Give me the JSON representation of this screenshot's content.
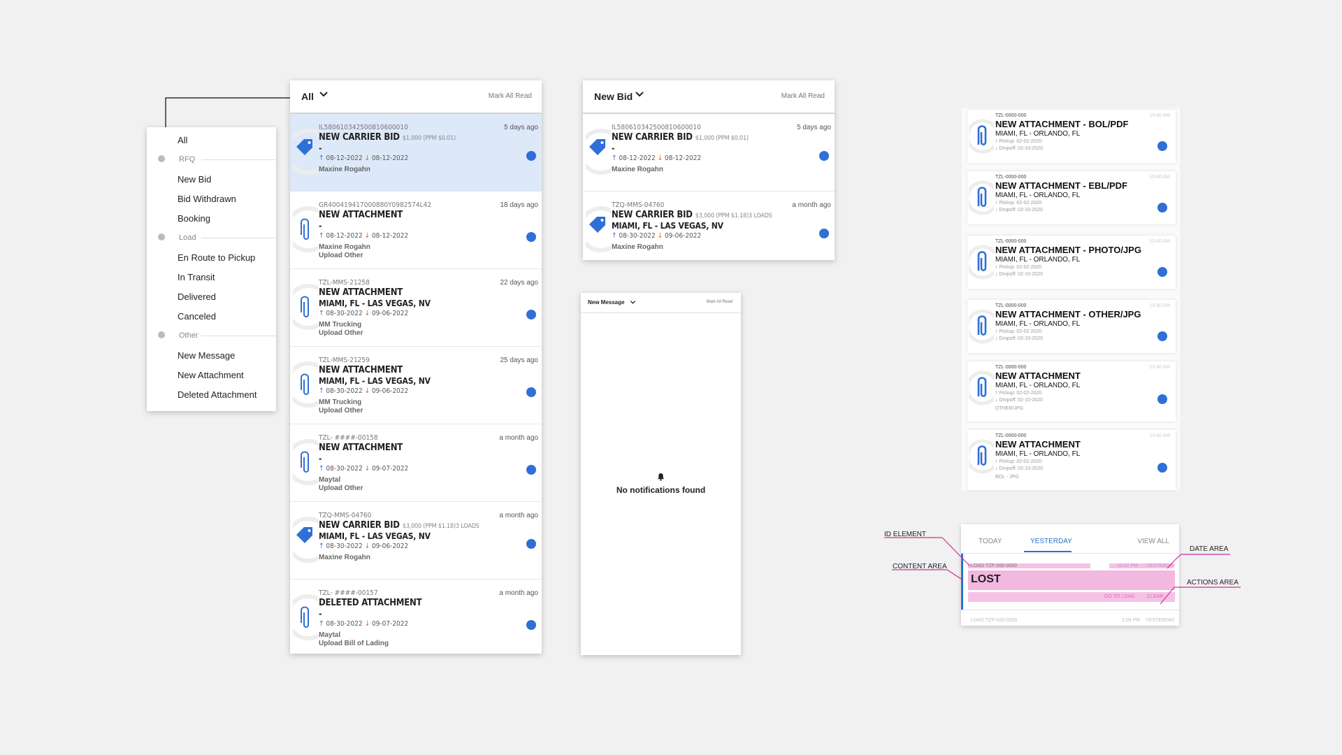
{
  "colors": {
    "accent": "#2f6fd6",
    "highlight_row": "#dde9f8",
    "pickup_arrow": "#2b72c9",
    "dropoff_arrow": "#e8671c",
    "annotation_magenta": "#d0309a",
    "annotation_fill": "#f5c2e6"
  },
  "filter_dropdown": {
    "items": [
      {
        "label": "All",
        "kind": "item"
      },
      {
        "label": "RFQ",
        "kind": "group",
        "icon": "tag-icon"
      },
      {
        "label": "New Bid",
        "kind": "item"
      },
      {
        "label": "Bid Withdrawn",
        "kind": "item"
      },
      {
        "label": "Booking",
        "kind": "item"
      },
      {
        "label": "Load",
        "kind": "group",
        "icon": "truck-icon"
      },
      {
        "label": "En Route to Pickup",
        "kind": "item"
      },
      {
        "label": "In Transit",
        "kind": "item"
      },
      {
        "label": "Delivered",
        "kind": "item"
      },
      {
        "label": "Canceled",
        "kind": "item"
      },
      {
        "label": "Other",
        "kind": "group",
        "icon": "chat-icon"
      },
      {
        "label": "New Message",
        "kind": "item"
      },
      {
        "label": "New Attachment",
        "kind": "item"
      },
      {
        "label": "Deleted Attachment",
        "kind": "item"
      }
    ]
  },
  "panel_all": {
    "filter_label": "All",
    "mark_all_read": "Mark All Read",
    "items": [
      {
        "icon": "tag-icon",
        "code": "IL580610342500810600010",
        "time": "5 days ago",
        "title": "NEW CARRIER BID",
        "extra": "$1,000 (PPM $0.01)",
        "route": "-",
        "pickup": "08-12-2022",
        "dropoff": "08-12-2022",
        "who": "Maxine Rogahn",
        "sub": "",
        "highlighted": true
      },
      {
        "icon": "paperclip-icon",
        "code": "GR400419417000880Y0982574L42",
        "time": "18 days ago",
        "title": "NEW ATTACHMENT",
        "extra": "",
        "route": "-",
        "pickup": "08-12-2022",
        "dropoff": "08-12-2022",
        "who": "Maxine Rogahn",
        "sub": "Upload Other",
        "highlighted": false
      },
      {
        "icon": "paperclip-icon",
        "code": "TZL-MMS-21258",
        "time": "22 days ago",
        "title": "NEW ATTACHMENT",
        "extra": "",
        "route": "MIAMI, FL - LAS VEGAS, NV",
        "pickup": "08-30-2022",
        "dropoff": "09-06-2022",
        "who": "MM Trucking",
        "sub": "Upload Other",
        "highlighted": false
      },
      {
        "icon": "paperclip-icon",
        "code": "TZL-MMS-21259",
        "time": "25 days ago",
        "title": "NEW ATTACHMENT",
        "extra": "",
        "route": "MIAMI, FL - LAS VEGAS, NV",
        "pickup": "08-30-2022",
        "dropoff": "09-06-2022",
        "who": "MM Trucking",
        "sub": "Upload Other",
        "highlighted": false
      },
      {
        "icon": "paperclip-icon",
        "code": "TZL- ####-00158",
        "time": "a month ago",
        "title": "NEW ATTACHMENT",
        "extra": "",
        "route": "-",
        "pickup": "08-30-2022",
        "dropoff": "09-07-2022",
        "who": "Maytal",
        "sub": "Upload Other",
        "highlighted": false
      },
      {
        "icon": "tag-icon",
        "code": "TZQ-MMS-04760",
        "time": "a month ago",
        "title": "NEW CARRIER BID",
        "extra": "$3,000 (PPM $1.18)3 LOADS",
        "route": "MIAMI, FL - LAS VEGAS, NV",
        "pickup": "08-30-2022",
        "dropoff": "09-06-2022",
        "who": "Maxine Rogahn",
        "sub": "",
        "highlighted": false
      },
      {
        "icon": "paperclip-icon",
        "code": "TZL- ####-00157",
        "time": "a month ago",
        "title": "DELETED ATTACHMENT",
        "extra": "",
        "route": "-",
        "pickup": "08-30-2022",
        "dropoff": "09-07-2022",
        "who": "Maytal",
        "sub": "Upload Bill of Lading",
        "highlighted": false
      }
    ]
  },
  "panel_newbid": {
    "filter_label": "New Bid",
    "mark_all_read": "Mark All Read",
    "items": [
      {
        "icon": "tag-icon",
        "code": "IL580610342500810600010",
        "time": "5 days ago",
        "title": "NEW CARRIER BID",
        "extra": "$1,000 (PPM $0.01)",
        "route": "-",
        "pickup": "08-12-2022",
        "dropoff": "08-12-2022",
        "who": "Maxine Rogahn",
        "sub": ""
      },
      {
        "icon": "tag-icon",
        "code": "TZQ-MMS-04760",
        "time": "a month ago",
        "title": "NEW CARRIER BID",
        "extra": "$3,000 (PPM $1.18)3 LOADS",
        "route": "MIAMI, FL - LAS VEGAS, NV",
        "pickup": "08-30-2022",
        "dropoff": "09-06-2022",
        "who": "Maxine Rogahn",
        "sub": ""
      }
    ]
  },
  "panel_message": {
    "filter_label": "New Message",
    "mark_all_read": "Mark All Read",
    "empty_text": "No notifications found"
  },
  "attachment_cards": [
    {
      "code": "TZL-0000-000",
      "time": "10:40 AM",
      "title": "NEW ATTACHMENT - BOL/PDF",
      "route": "MIAMI, FL - ORLANDO, FL",
      "pickup": "Pickup: 02-02-2020",
      "dropoff": "Dropoff: 02-10-2020",
      "note": ""
    },
    {
      "code": "TZL-0000-000",
      "time": "10:40 AM",
      "title": "NEW ATTACHMENT - EBL/PDF",
      "route": "MIAMI, FL - ORLANDO, FL",
      "pickup": "Pickup: 02-02-2020",
      "dropoff": "Dropoff: 02-10-2020",
      "note": ""
    },
    {
      "code": "TZL-0000-000",
      "time": "10:40 AM",
      "title": "NEW ATTACHMENT - PHOTO/JPG",
      "route": "MIAMI, FL - ORLANDO, FL",
      "pickup": "Pickup: 02-02-2020",
      "dropoff": "Dropoff: 02-10-2020",
      "note": ""
    },
    {
      "code": "TZL-0000-000",
      "time": "10:40 AM",
      "title": "NEW ATTACHMENT - OTHER/JPG",
      "route": "MIAMI, FL - ORLANDO, FL",
      "pickup": "Pickup: 02-02-2020",
      "dropoff": "Dropoff: 02-10-2020",
      "note": ""
    },
    {
      "code": "TZL-0000-000",
      "time": "10:40 AM",
      "title": "NEW ATTACHMENT",
      "route": "MIAMI, FL - ORLANDO, FL",
      "pickup": "Pickup: 02-02-2020",
      "dropoff": "Dropoff: 02-10-2020",
      "note": "OTHER/JPG"
    },
    {
      "code": "TZL-0000-000",
      "time": "10:40 AM",
      "title": "NEW ATTACHMENT",
      "route": "MIAMI, FL - ORLANDO, FL",
      "pickup": "Pickup: 02-02-2020",
      "dropoff": "Dropoff: 02-10-2020",
      "note": "BOL - JPG"
    }
  ],
  "anatomy": {
    "tab_today": "TODAY",
    "tab_yesterday": "YESTERDAY",
    "view_all": "VIEW ALL",
    "load_id": "LOAD TZP-000-0000",
    "time": "10:42 PM",
    "time_day": "YESTERDAY",
    "status": "LOST",
    "go_to_load": "GO TO LOAD",
    "clear": "CLEAR",
    "next_load_id": "LOAD TZP-000-0000",
    "next_time": "2:09 PM",
    "next_day": "YESTERDAY",
    "labels": {
      "id": "ID ELEMENT",
      "content": "CONTENT AREA",
      "date": "DATE AREA",
      "actions": "ACTIONS AREA"
    }
  }
}
